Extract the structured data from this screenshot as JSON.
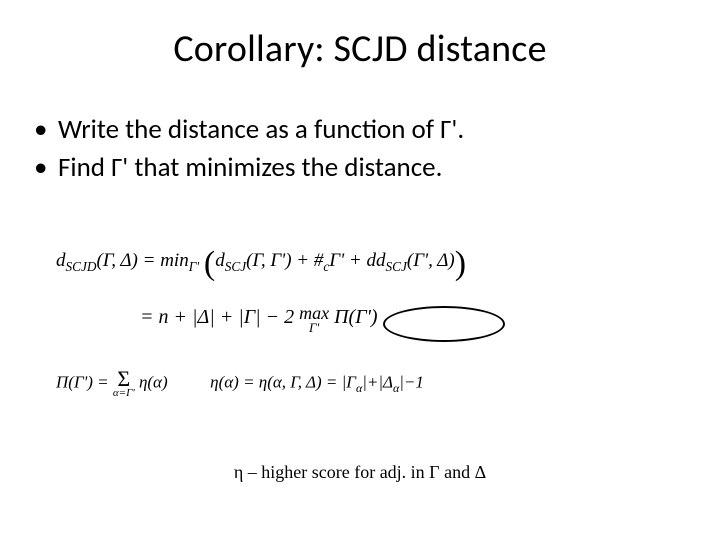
{
  "title": "Corollary: SCJD distance",
  "bullets": {
    "b1": "Write the distance as a function of Γ'.",
    "b2": "Find Γ' that minimizes the distance."
  },
  "equations": {
    "eq1_lhs": "d",
    "eq1_sub1": "SCJD",
    "eq1_args1": "(Γ, Δ) = min",
    "eq1_minsub": "Γ'",
    "eq1_dscj": "d",
    "eq1_sub2": "SCJ",
    "eq1_mid": "(Γ, Γ') + #",
    "eq1_c": "c",
    "eq1_mid2": "Γ' + dd",
    "eq1_sub3": "SCJ",
    "eq1_end": "(Γ', Δ)",
    "eq2_lhs": "= n + |Δ| + |Γ| − 2",
    "eq2_max": "max",
    "eq2_maxsub": "Γ'",
    "eq2_rhs": " Π(Γ')",
    "eq3_lhs": "Π(Γ') = ",
    "eq3_sig": "Σ",
    "eq3_sigsub": "α=Γ'",
    "eq3_mid": " η(α)",
    "eq3_gap": "          ",
    "eq3_rhs1": "η(α) = η(α, Γ, Δ) = |Γ",
    "eq3_sub_a": "α",
    "eq3_rhs2": "|+|Δ",
    "eq3_rhs3": "|−1"
  },
  "caption": "η – higher score for adj. in Γ and Δ"
}
